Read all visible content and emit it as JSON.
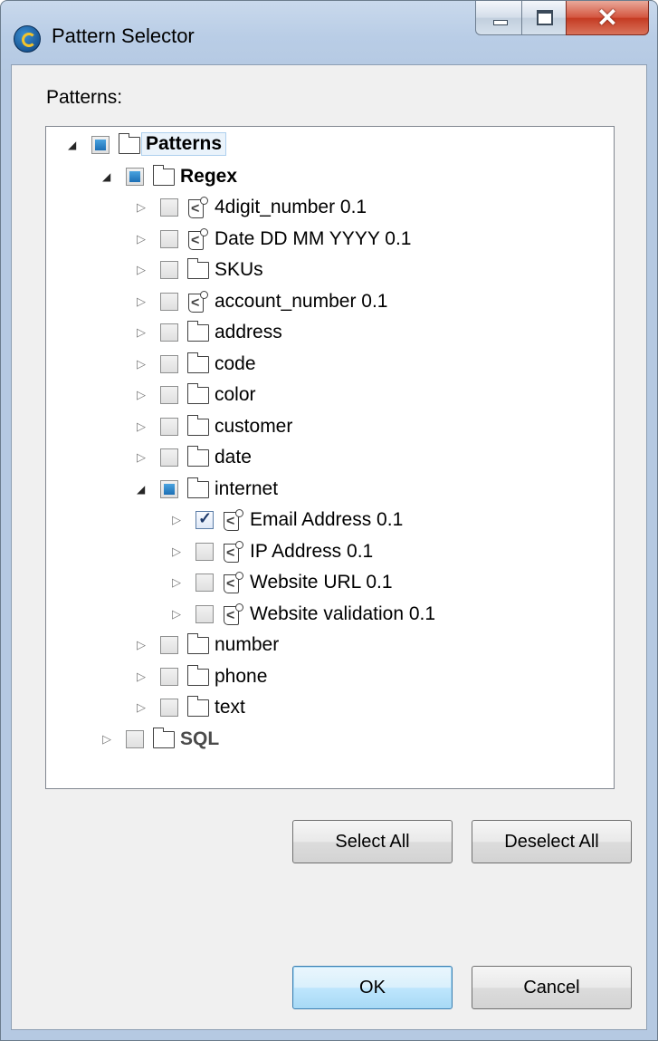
{
  "window": {
    "title": "Pattern Selector"
  },
  "labels": {
    "patterns": "Patterns:"
  },
  "tree": [
    {
      "label": "Patterns",
      "level": 0,
      "icon": "folder",
      "check": "partial",
      "expander": "open",
      "bold": true,
      "selected": true
    },
    {
      "label": "Regex",
      "level": 1,
      "icon": "folder",
      "check": "partial",
      "expander": "open",
      "bold": true
    },
    {
      "label": "4digit_number 0.1",
      "level": 2,
      "icon": "pattern",
      "check": "unchecked",
      "expander": "closed"
    },
    {
      "label": "Date DD MM YYYY 0.1",
      "level": 2,
      "icon": "pattern",
      "check": "unchecked",
      "expander": "closed"
    },
    {
      "label": "SKUs",
      "level": 2,
      "icon": "folder",
      "check": "unchecked",
      "expander": "closed"
    },
    {
      "label": "account_number 0.1",
      "level": 2,
      "icon": "pattern",
      "check": "unchecked",
      "expander": "closed"
    },
    {
      "label": "address",
      "level": 2,
      "icon": "folder",
      "check": "unchecked",
      "expander": "closed"
    },
    {
      "label": "code",
      "level": 2,
      "icon": "folder",
      "check": "unchecked",
      "expander": "closed"
    },
    {
      "label": "color",
      "level": 2,
      "icon": "folder",
      "check": "unchecked",
      "expander": "closed"
    },
    {
      "label": "customer",
      "level": 2,
      "icon": "folder",
      "check": "unchecked",
      "expander": "closed"
    },
    {
      "label": "date",
      "level": 2,
      "icon": "folder",
      "check": "unchecked",
      "expander": "closed"
    },
    {
      "label": "internet",
      "level": 2,
      "icon": "folder",
      "check": "partial",
      "expander": "open"
    },
    {
      "label": "Email Address 0.1",
      "level": 3,
      "icon": "pattern",
      "check": "checked",
      "expander": "closed"
    },
    {
      "label": "IP Address 0.1",
      "level": 3,
      "icon": "pattern",
      "check": "unchecked",
      "expander": "closed"
    },
    {
      "label": "Website URL 0.1",
      "level": 3,
      "icon": "pattern",
      "check": "unchecked",
      "expander": "closed"
    },
    {
      "label": "Website validation 0.1",
      "level": 3,
      "icon": "pattern",
      "check": "unchecked",
      "expander": "closed"
    },
    {
      "label": "number",
      "level": 2,
      "icon": "folder",
      "check": "unchecked",
      "expander": "closed"
    },
    {
      "label": "phone",
      "level": 2,
      "icon": "folder",
      "check": "unchecked",
      "expander": "closed"
    },
    {
      "label": "text",
      "level": 2,
      "icon": "folder",
      "check": "unchecked",
      "expander": "closed"
    },
    {
      "label": "SQL",
      "level": 1,
      "icon": "folder",
      "check": "unchecked",
      "expander": "closed",
      "sql": true
    }
  ],
  "buttons": {
    "select_all": "Select All",
    "deselect_all": "Deselect All",
    "ok": "OK",
    "cancel": "Cancel"
  },
  "colors": {
    "accent": "#1c6fb5",
    "titlebar": "#b9cde6",
    "close": "#c43a22"
  }
}
